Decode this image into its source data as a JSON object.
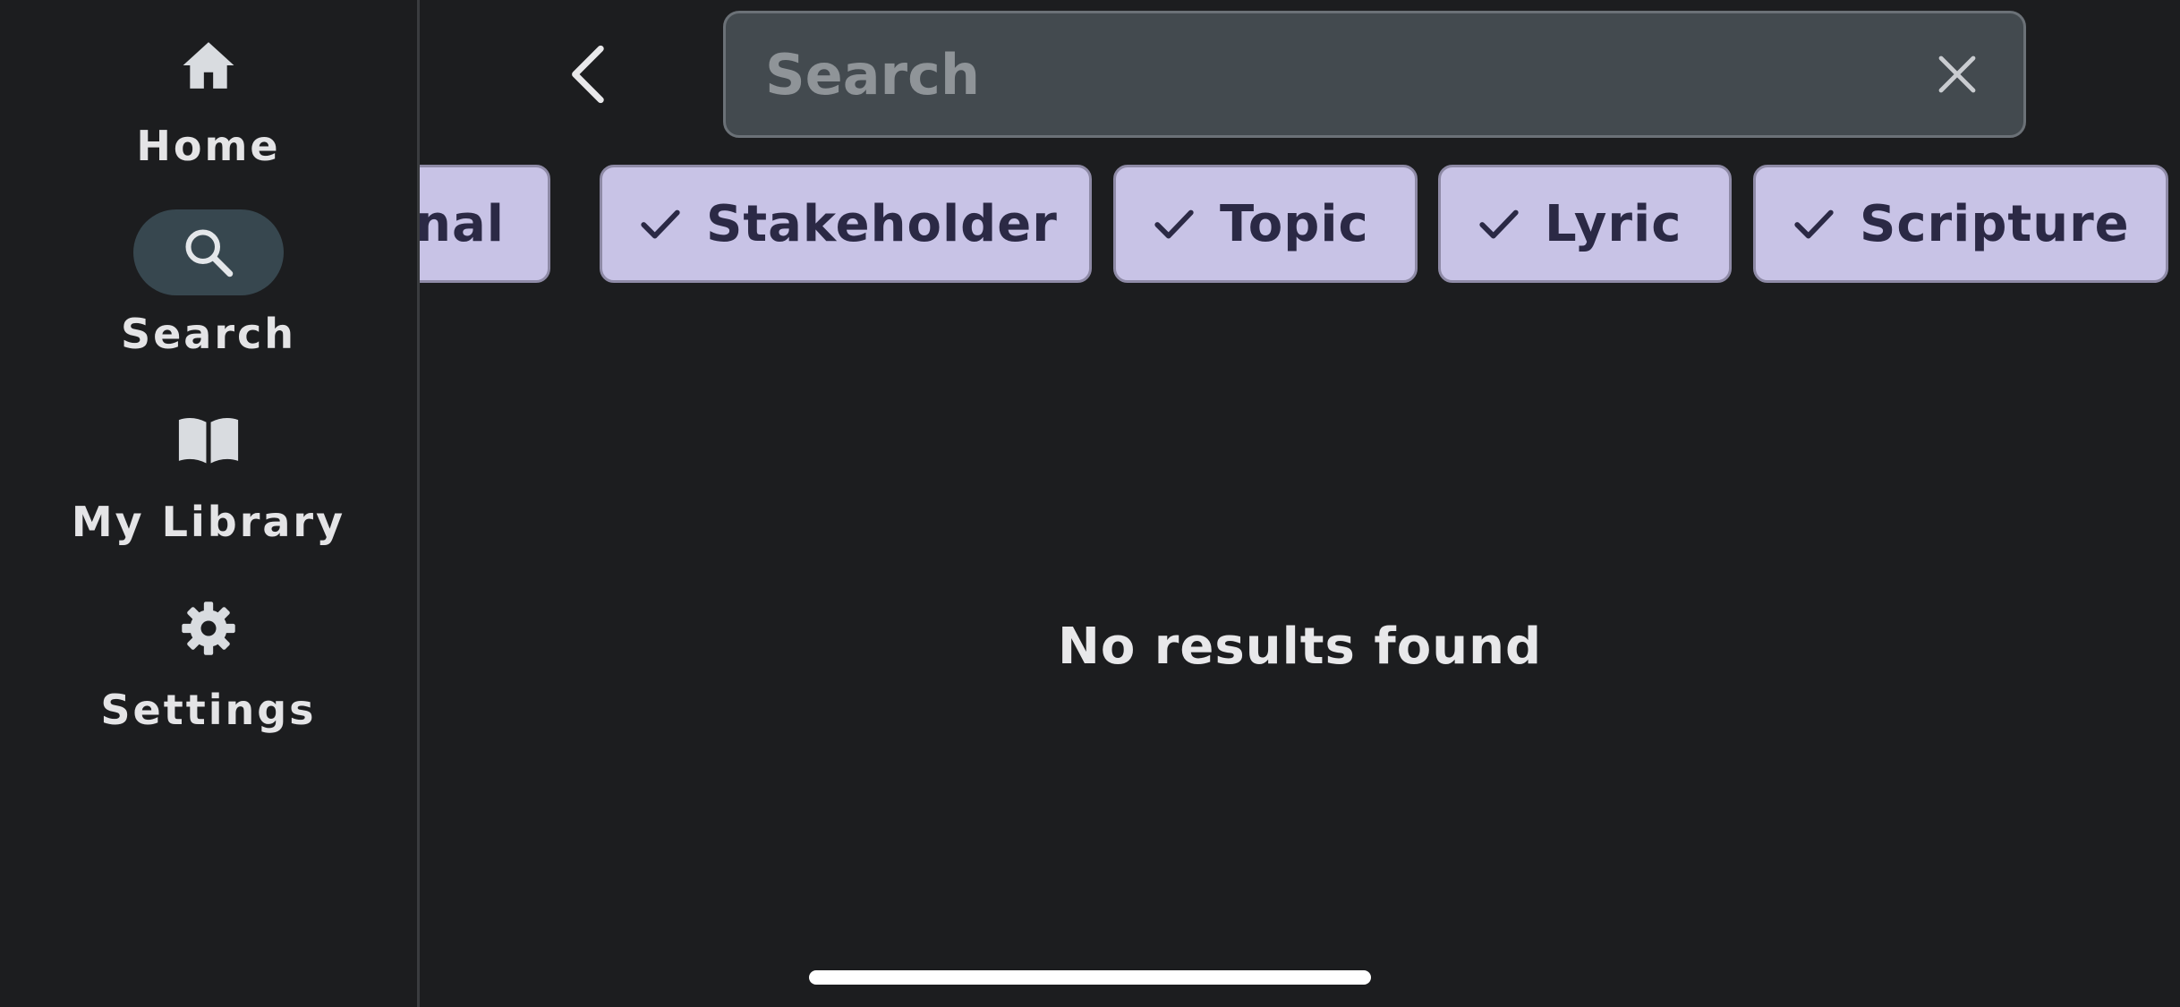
{
  "sidebar": {
    "items": [
      {
        "label": "Home",
        "icon": "home-icon"
      },
      {
        "label": "Search",
        "icon": "search-icon",
        "active": true
      },
      {
        "label": "My Library",
        "icon": "book-icon"
      },
      {
        "label": "Settings",
        "icon": "gear-icon"
      }
    ]
  },
  "search": {
    "placeholder": "Search",
    "value": ""
  },
  "filters": {
    "chips": [
      {
        "label": "mnal",
        "checked": true
      },
      {
        "label": "Stakeholder",
        "checked": true
      },
      {
        "label": "Topic",
        "checked": true
      },
      {
        "label": "Lyric",
        "checked": true
      },
      {
        "label": "Scripture",
        "checked": true
      }
    ]
  },
  "results": {
    "empty_message": "No results found"
  },
  "colors": {
    "background": "#1c1d1f",
    "chip_background": "#c8c3e6",
    "chip_text": "#2b2945",
    "active_nav_pill": "#37474f",
    "search_field": "#434a4f"
  }
}
